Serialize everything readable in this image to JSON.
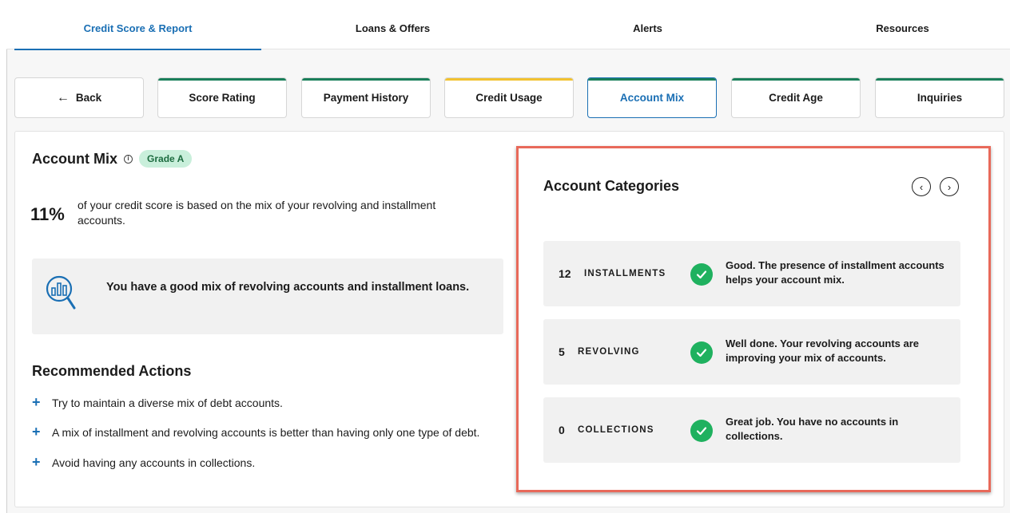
{
  "topnav": {
    "tabs": [
      {
        "label": "Credit Score & Report",
        "active": true
      },
      {
        "label": "Loans & Offers",
        "active": false
      },
      {
        "label": "Alerts",
        "active": false
      },
      {
        "label": "Resources",
        "active": false
      }
    ]
  },
  "subnav": {
    "back_label": "Back",
    "tabs": [
      {
        "label": "Score Rating",
        "bar_color": "#1a7f5a"
      },
      {
        "label": "Payment History",
        "bar_color": "#1a7f5a"
      },
      {
        "label": "Credit Usage",
        "bar_color": "#f2c230"
      },
      {
        "label": "Account Mix",
        "bar_color": "#1a7f5a",
        "active": true
      },
      {
        "label": "Credit Age",
        "bar_color": "#1a7f5a"
      },
      {
        "label": "Inquiries",
        "bar_color": "#1a7f5a"
      }
    ]
  },
  "main": {
    "title": "Account Mix",
    "grade": "Grade A",
    "percent": "11%",
    "percent_desc": "of your credit score is based on the mix of your revolving and installment accounts.",
    "mix_message": "You have a good mix of revolving accounts and installment loans.",
    "recommended_title": "Recommended Actions",
    "actions": [
      "Try to maintain a diverse mix of debt accounts.",
      "A mix of installment and revolving accounts is better than having only one type of debt.",
      "Avoid having any accounts in collections."
    ]
  },
  "categories": {
    "title": "Account Categories",
    "rows": [
      {
        "count": "12",
        "label": "INSTALLMENTS",
        "message": "Good. The presence of installment accounts helps your account mix."
      },
      {
        "count": "5",
        "label": "REVOLVING",
        "message": "Well done. Your revolving accounts are improving your mix of accounts."
      },
      {
        "count": "0",
        "label": "COLLECTIONS",
        "message": "Great job. You have no accounts in collections."
      }
    ]
  },
  "colors": {
    "accent": "#1a6fb4",
    "good": "#1fb15f",
    "highlight_border": "#e8695a",
    "grade_bg": "#c9efdb"
  }
}
